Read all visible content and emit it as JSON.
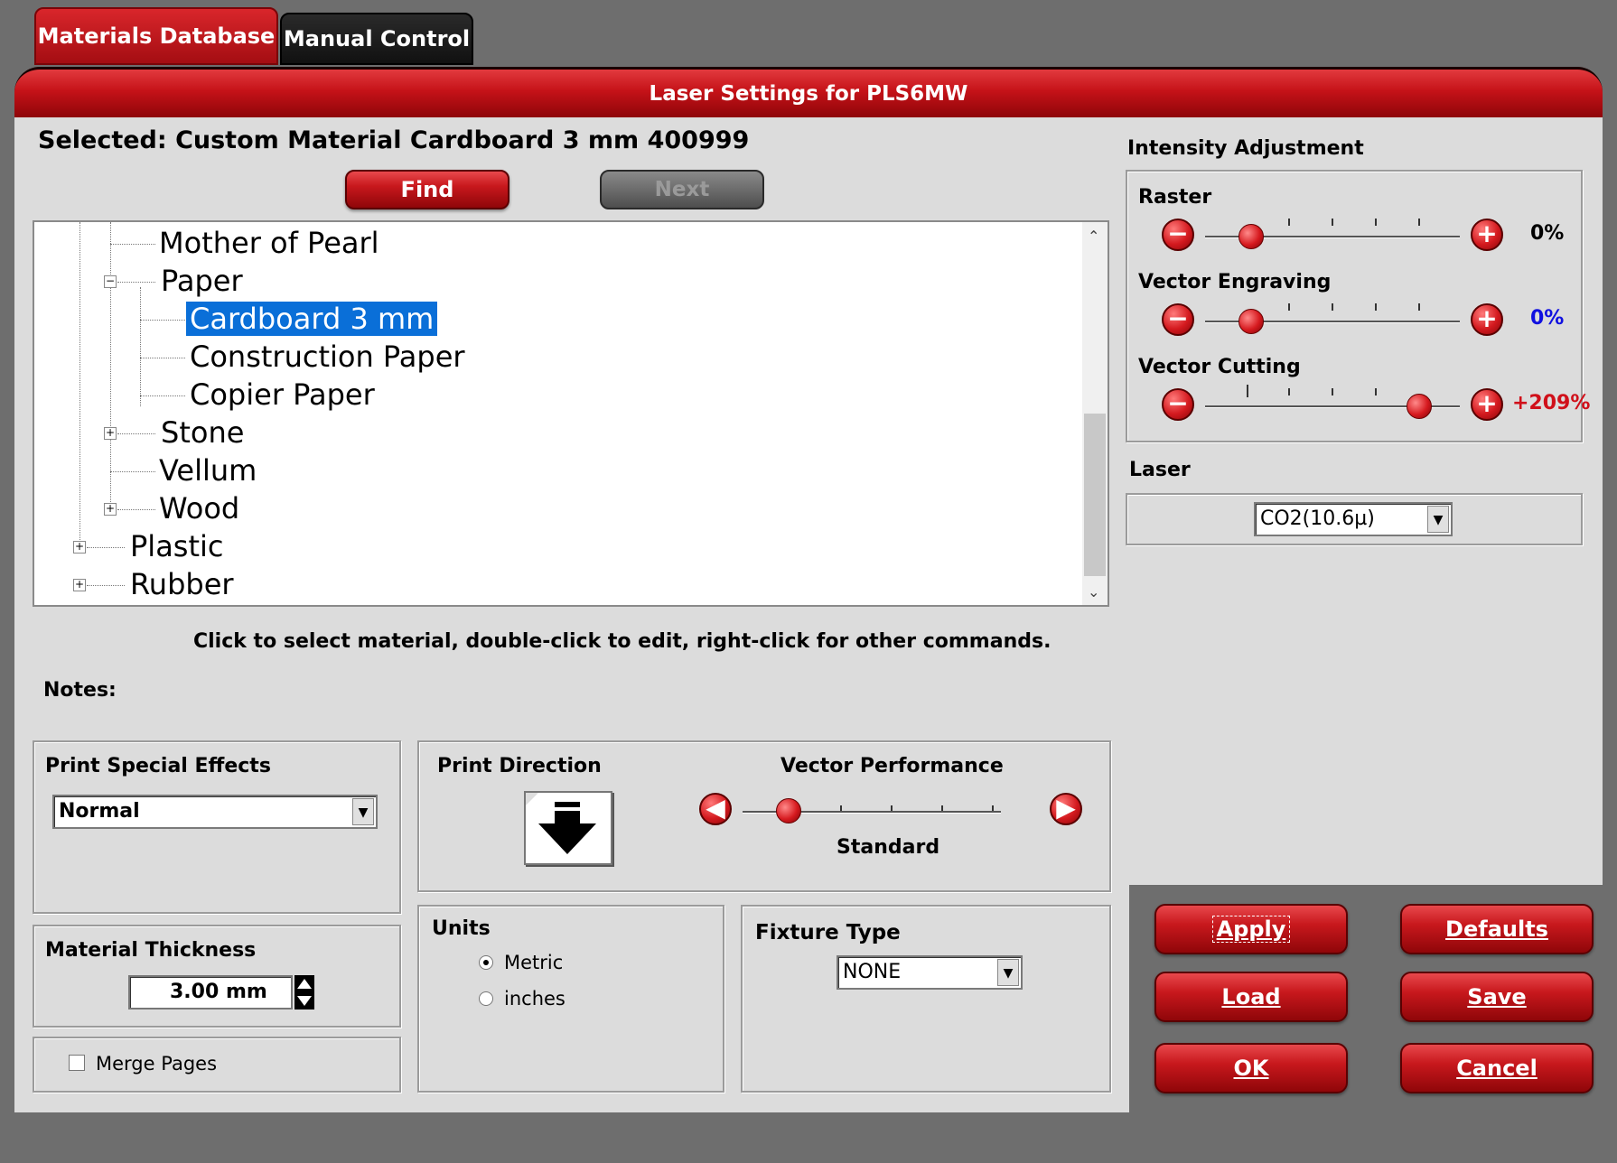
{
  "tabs": [
    {
      "label": "Materials Database",
      "active": true
    },
    {
      "label": "Manual Control",
      "active": false
    }
  ],
  "header": {
    "title": "Laser Settings for PLS6MW"
  },
  "selected": {
    "text": "Selected: Custom Material Cardboard 3 mm 400999"
  },
  "buttons": {
    "find": "Find",
    "next": "Next",
    "apply": "Apply",
    "defaults": "Defaults",
    "load": "Load",
    "save": "Save",
    "ok": "OK",
    "cancel": "Cancel"
  },
  "tree": {
    "items": [
      {
        "label": "Mother of Pearl",
        "level": 2,
        "expander": null
      },
      {
        "label": "Paper",
        "level": 2,
        "expander": "-"
      },
      {
        "label": "Cardboard 3 mm",
        "level": 3,
        "expander": null,
        "selected": true
      },
      {
        "label": "Construction Paper",
        "level": 3,
        "expander": null
      },
      {
        "label": "Copier Paper",
        "level": 3,
        "expander": null
      },
      {
        "label": "Stone",
        "level": 2,
        "expander": "+"
      },
      {
        "label": "Vellum",
        "level": 2,
        "expander": null
      },
      {
        "label": "Wood",
        "level": 2,
        "expander": "+"
      },
      {
        "label": "Plastic",
        "level": 1,
        "expander": "+"
      },
      {
        "label": "Rubber",
        "level": 1,
        "expander": "+"
      }
    ]
  },
  "hint": "Click to select material, double-click to edit, right-click for other commands.",
  "notes_label": "Notes:",
  "intensity": {
    "title": "Intensity Adjustment",
    "raster": {
      "label": "Raster",
      "value": "0%",
      "level": 0.18
    },
    "vector_engraving": {
      "label": "Vector Engraving",
      "value": "0%",
      "level": 0.18,
      "value_color": "#1010e0"
    },
    "vector_cutting": {
      "label": "Vector Cutting",
      "value": "+209%",
      "level": 0.84,
      "value_color": "#d0101a"
    }
  },
  "laser": {
    "title": "Laser",
    "selected": "CO2(10.6µ)"
  },
  "print_effects": {
    "title": "Print Special Effects",
    "selected": "Normal"
  },
  "print_direction": {
    "title": "Print Direction",
    "icon": "arrow-down-icon"
  },
  "vector_performance": {
    "title": "Vector Performance",
    "value": "Standard",
    "level": 0.18
  },
  "material_thickness": {
    "title": "Material Thickness",
    "value": "3.00 mm"
  },
  "merge_pages": {
    "label": "Merge Pages",
    "checked": false
  },
  "units": {
    "title": "Units",
    "options": [
      "Metric",
      "inches"
    ],
    "selected": "Metric"
  },
  "fixture": {
    "title": "Fixture Type",
    "selected": "NONE"
  },
  "colors": {
    "accent": "#c8181d",
    "selection": "#0a6fd8"
  }
}
